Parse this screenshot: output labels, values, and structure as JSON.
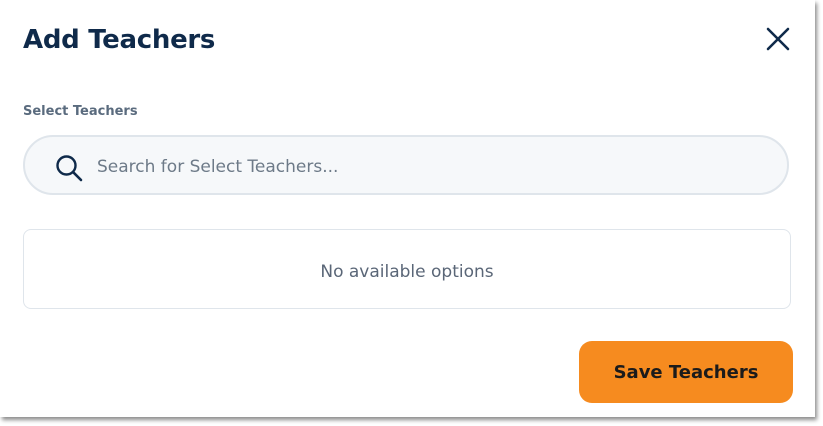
{
  "dialog": {
    "title": "Add Teachers",
    "close_icon": "close-icon"
  },
  "field": {
    "label": "Select Teachers",
    "search_icon": "search-icon",
    "placeholder": "Search for Select Teachers...",
    "value": ""
  },
  "options": {
    "empty_text": "No available options"
  },
  "actions": {
    "save_label": "Save Teachers"
  },
  "colors": {
    "title": "#0f2a4a",
    "accent_button": "#f68b1f",
    "input_background": "#f6f8fa",
    "border": "#dfe5eb"
  }
}
